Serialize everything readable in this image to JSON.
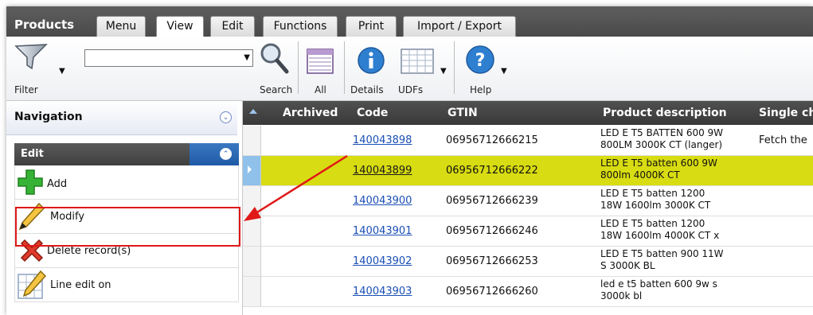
{
  "app": {
    "title": "Products"
  },
  "tabs": [
    {
      "label": "Menu"
    },
    {
      "label": "View"
    },
    {
      "label": "Edit"
    },
    {
      "label": "Functions"
    },
    {
      "label": "Print"
    },
    {
      "label": "Import / Export"
    }
  ],
  "toolbar": {
    "filter_label": "Filter",
    "search_label": "Search",
    "all_label": "All",
    "details_label": "Details",
    "udfs_label": "UDFs",
    "help_label": "Help",
    "search_value": ""
  },
  "sidebar": {
    "navigation_label": "Navigation",
    "edit_label": "Edit",
    "actions": [
      {
        "label": "Add",
        "icon": "plus-icon"
      },
      {
        "label": "Modify",
        "icon": "pencil-icon"
      },
      {
        "label": "Delete record(s)",
        "icon": "delete-icon"
      },
      {
        "label": "Line edit on",
        "icon": "line-edit-icon"
      }
    ]
  },
  "grid": {
    "columns": [
      "Archived",
      "Code",
      "GTIN",
      "Product description",
      "Single ch"
    ],
    "rows": [
      {
        "code": "140043898",
        "gtin": "06956712666215",
        "desc1": "LED E T5 BATTEN 600 9W",
        "desc2": "800LM 3000K CT (langer)",
        "single": "Fetch the"
      },
      {
        "code": "140043899",
        "gtin": "06956712666222",
        "desc1": "LED E T5 batten 600 9W",
        "desc2": "800lm 4000K CT",
        "single": ""
      },
      {
        "code": "140043900",
        "gtin": "06956712666239",
        "desc1": "LED E T5 batten 1200",
        "desc2": "18W 1600lm 3000K CT",
        "single": ""
      },
      {
        "code": "140043901",
        "gtin": "06956712666246",
        "desc1": "LED E T5 batten 1200",
        "desc2": "18W 1600lm 4000K CT x",
        "single": ""
      },
      {
        "code": "140043902",
        "gtin": "06956712666253",
        "desc1": "LED E T5 batten 900 11W",
        "desc2": "S 3000K BL",
        "single": ""
      },
      {
        "code": "140043903",
        "gtin": "06956712666260",
        "desc1": "led e t5 batten 600 9w s",
        "desc2": "3000k bl",
        "single": ""
      }
    ]
  },
  "colors": {
    "selected_row": "#d8dc12",
    "highlight": "#e01818",
    "link": "#1a4fb5"
  }
}
